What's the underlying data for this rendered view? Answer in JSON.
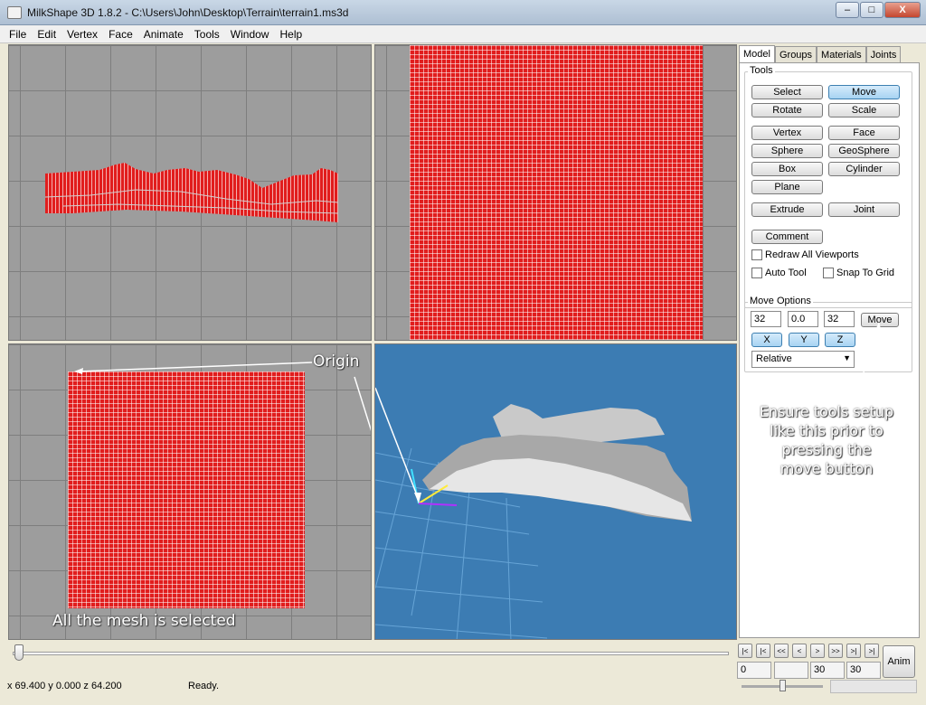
{
  "window": {
    "title": "MilkShape 3D 1.8.2 - C:\\Users\\John\\Desktop\\Terrain\\terrain1.ms3d",
    "minimize_label": "–",
    "maximize_label": "□",
    "close_label": "X"
  },
  "menu": [
    "File",
    "Edit",
    "Vertex",
    "Face",
    "Animate",
    "Tools",
    "Window",
    "Help"
  ],
  "annotations": {
    "origin": "Origin",
    "mesh_selected": "All the mesh is selected",
    "tools_note": [
      "Ensure tools setup",
      "like this prior to",
      "pressing the",
      "move button"
    ]
  },
  "panel": {
    "tabs": [
      "Model",
      "Groups",
      "Materials",
      "Joints"
    ],
    "active_tab": "Model",
    "tools_label": "Tools",
    "tool_buttons": {
      "select": "Select",
      "move": "Move",
      "rotate": "Rotate",
      "scale": "Scale",
      "vertex": "Vertex",
      "face": "Face",
      "sphere": "Sphere",
      "geosphere": "GeoSphere",
      "box": "Box",
      "cylinder": "Cylinder",
      "plane": "Plane",
      "extrude": "Extrude",
      "joint": "Joint",
      "comment": "Comment"
    },
    "active_tool": "Move",
    "checkboxes": {
      "redraw": "Redraw All Viewports",
      "auto_tool": "Auto Tool",
      "snap": "Snap To Grid"
    },
    "move_options": {
      "label": "Move Options",
      "x": "32",
      "y": "0.0",
      "z": "32",
      "move_button": "Move",
      "axis_x": "X",
      "axis_y": "Y",
      "axis_z": "Z",
      "mode": "Relative"
    }
  },
  "timeline": {
    "frame_current": "0",
    "frame_a": "30",
    "frame_b": "30",
    "anim_button": "Anim",
    "nav_glyphs": [
      "|<",
      "|<",
      "<<",
      "<",
      ">",
      ">>",
      ">|",
      ">|"
    ]
  },
  "status": {
    "coords": "x 69.400 y 0.000 z 64.200",
    "message": "Ready."
  }
}
